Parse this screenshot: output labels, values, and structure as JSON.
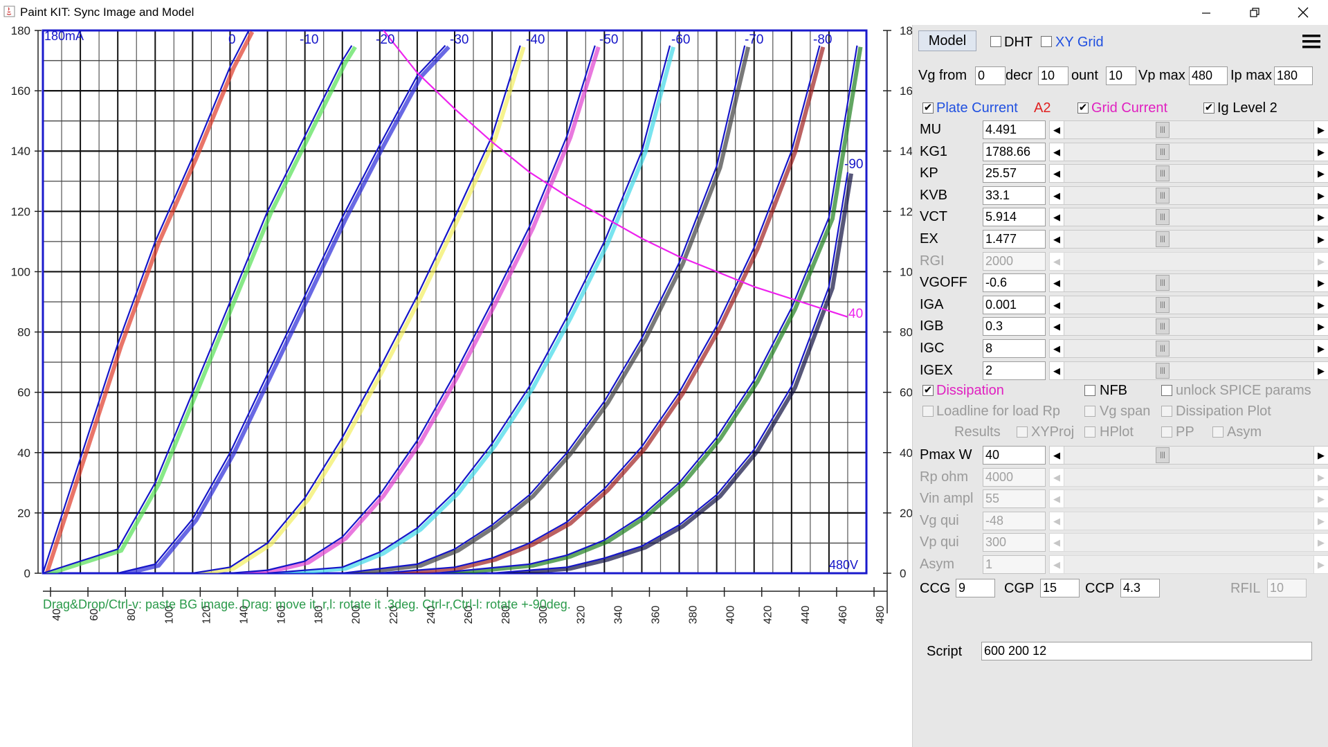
{
  "window": {
    "title": "Paint KIT: Sync Image and Model",
    "controls": [
      "minimize",
      "restore",
      "close"
    ]
  },
  "plot": {
    "y_max_label": "180mA",
    "x_max_label": "480V",
    "y_ticks_left": [
      "180",
      "160",
      "140",
      "120",
      "100",
      "80",
      "60",
      "40",
      "20",
      "0"
    ],
    "y_ticks_right": [
      "18",
      "16",
      "14",
      "12",
      "10",
      "80",
      "60",
      "40",
      "20",
      "0"
    ],
    "x_ticks": [
      "40",
      "60",
      "80",
      "100",
      "120",
      "140",
      "160",
      "180",
      "200",
      "220",
      "240",
      "260",
      "280",
      "300",
      "320",
      "340",
      "360",
      "380",
      "400",
      "420",
      "440",
      "460",
      "480"
    ],
    "curve_labels": [
      "0",
      "-10",
      "-20",
      "-30",
      "-40",
      "-50",
      "-60",
      "-70",
      "-80",
      "-90"
    ],
    "dissipation_label": "40",
    "hint": "Drag&Drop/Ctrl-v: paste BG image. Drag: move it. r,l: rotate it .3deg. Ctrl-r,Ctrl-l: rotate +-90deg.",
    "colors": {
      "frame": "#1a1acc",
      "model_curve": "#1515c8",
      "dissipation": "#ee22ee",
      "hint": "#2a9a4a",
      "bg_curves": [
        "#e03a2a",
        "#55e055",
        "#2a2ad8",
        "#f2ee60",
        "#e040d0",
        "#40d8e8",
        "#404040",
        "#a02020",
        "#208020",
        "#101040"
      ]
    }
  },
  "chart_data": {
    "type": "line",
    "title": "",
    "xlabel": "480V",
    "ylabel": "180mA",
    "xlim": [
      40,
      480
    ],
    "ylim": [
      0,
      180
    ],
    "grid": true,
    "series": [
      {
        "name": "0",
        "x": [
          40,
          60,
          80,
          100,
          120,
          140,
          150
        ],
        "y": [
          0,
          38,
          76,
          110,
          138,
          168,
          180
        ]
      },
      {
        "name": "-10",
        "x": [
          40,
          80,
          100,
          120,
          140,
          160,
          180,
          200,
          205
        ],
        "y": [
          0,
          8,
          30,
          60,
          90,
          120,
          145,
          170,
          175
        ]
      },
      {
        "name": "-20",
        "x": [
          80,
          100,
          120,
          140,
          160,
          180,
          200,
          220,
          240,
          255
        ],
        "y": [
          0,
          3,
          18,
          40,
          66,
          92,
          118,
          142,
          165,
          175
        ]
      },
      {
        "name": "-30",
        "x": [
          120,
          140,
          160,
          180,
          200,
          220,
          240,
          260,
          280,
          295
        ],
        "y": [
          0,
          2,
          10,
          25,
          45,
          68,
          92,
          118,
          145,
          175
        ]
      },
      {
        "name": "-40",
        "x": [
          140,
          160,
          180,
          200,
          220,
          240,
          260,
          280,
          300,
          320,
          335
        ],
        "y": [
          0,
          1,
          4,
          12,
          26,
          44,
          66,
          90,
          115,
          145,
          175
        ]
      },
      {
        "name": "-50",
        "x": [
          160,
          200,
          220,
          240,
          260,
          280,
          300,
          320,
          340,
          360,
          375
        ],
        "y": [
          0,
          2,
          7,
          15,
          27,
          43,
          62,
          85,
          110,
          140,
          175
        ]
      },
      {
        "name": "-60",
        "x": [
          200,
          240,
          260,
          280,
          300,
          320,
          340,
          360,
          380,
          400,
          415
        ],
        "y": [
          0,
          3,
          8,
          16,
          26,
          40,
          57,
          78,
          103,
          135,
          175
        ]
      },
      {
        "name": "-70",
        "x": [
          220,
          260,
          280,
          300,
          320,
          340,
          360,
          380,
          400,
          420,
          440,
          455
        ],
        "y": [
          0,
          2,
          5,
          10,
          17,
          28,
          42,
          60,
          82,
          108,
          140,
          175
        ]
      },
      {
        "name": "-80",
        "x": [
          250,
          300,
          320,
          340,
          360,
          380,
          400,
          420,
          440,
          460,
          475
        ],
        "y": [
          0,
          3,
          6,
          11,
          19,
          30,
          45,
          64,
          88,
          118,
          175
        ]
      },
      {
        "name": "-90",
        "x": [
          280,
          320,
          340,
          360,
          380,
          400,
          420,
          440,
          460,
          470
        ],
        "y": [
          0,
          2,
          5,
          9,
          16,
          26,
          41,
          62,
          95,
          133
        ]
      },
      {
        "name": "Pmax 40 W",
        "x": [
          222,
          240,
          260,
          280,
          300,
          320,
          340,
          360,
          380,
          400,
          420,
          440,
          460,
          470
        ],
        "y": [
          180,
          166,
          154,
          143,
          133,
          125,
          118,
          111,
          105,
          100,
          95,
          91,
          87,
          85
        ]
      }
    ]
  },
  "panel": {
    "model_button": "Model",
    "dht": {
      "label": "DHT",
      "checked": false
    },
    "xy_grid": {
      "label": "XY Grid",
      "checked": false
    },
    "menu_icon": "hamburger-menu-icon",
    "vg_from": {
      "label": "Vg from",
      "value": "0"
    },
    "decr": {
      "label": "decr",
      "value": "10"
    },
    "count": {
      "label": "ount",
      "value": "10"
    },
    "vp_max": {
      "label": "Vp max",
      "value": "480"
    },
    "ip_max": {
      "label": "Ip max",
      "value": "180"
    },
    "plate_current": {
      "label": "Plate Current",
      "checked": true,
      "color": "#2050e0"
    },
    "a2": {
      "label": "A2",
      "color": "#e02020"
    },
    "grid_current": {
      "label": "Grid Current",
      "checked": true,
      "color": "#e020c0"
    },
    "ig_level": {
      "label": "Ig Level 2",
      "checked": true
    },
    "params": [
      {
        "label": "MU",
        "value": "4.491",
        "enabled": true
      },
      {
        "label": "KG1",
        "value": "1788.66",
        "enabled": true
      },
      {
        "label": "KP",
        "value": "25.57",
        "enabled": true
      },
      {
        "label": "KVB",
        "value": "33.1",
        "enabled": true
      },
      {
        "label": "VCT",
        "value": "5.914",
        "enabled": true
      },
      {
        "label": "EX",
        "value": "1.477",
        "enabled": true
      },
      {
        "label": "RGI",
        "value": "2000",
        "enabled": false
      },
      {
        "label": "VGOFF",
        "value": "-0.6",
        "enabled": true
      },
      {
        "label": "IGA",
        "value": "0.001",
        "enabled": true
      },
      {
        "label": "IGB",
        "value": "0.3",
        "enabled": true
      },
      {
        "label": "IGC",
        "value": "8",
        "enabled": true
      },
      {
        "label": "IGEX",
        "value": "2",
        "enabled": true
      }
    ],
    "dissipation": {
      "label": "Dissipation",
      "checked": true,
      "color": "#e020c0"
    },
    "nfb": {
      "label": "NFB",
      "checked": false
    },
    "unlock_spice": {
      "label": "unlock SPICE params",
      "checked": false
    },
    "loadline": {
      "label": "Loadline for load Rp",
      "checked": false
    },
    "vg_span": {
      "label": "Vg span",
      "checked": false
    },
    "dissipation_plot": {
      "label": "Dissipation Plot",
      "checked": false
    },
    "results": {
      "label": "Results"
    },
    "xyproj": {
      "label": "XYProj",
      "checked": false
    },
    "hplot": {
      "label": "HPlot",
      "checked": false
    },
    "pp": {
      "label": "PP",
      "checked": false
    },
    "asym_cb": {
      "label": "Asym",
      "checked": false
    },
    "params2": [
      {
        "label": "Pmax W",
        "value": "40",
        "enabled": true
      },
      {
        "label": "Rp ohm",
        "value": "4000",
        "enabled": false
      },
      {
        "label": "Vin ampl",
        "value": "55",
        "enabled": false
      },
      {
        "label": "Vg qui",
        "value": "-48",
        "enabled": false
      },
      {
        "label": "Vp qui",
        "value": "300",
        "enabled": false
      },
      {
        "label": "Asym",
        "value": "1",
        "enabled": false
      }
    ],
    "ccg": {
      "label": "CCG",
      "value": "9"
    },
    "cgp": {
      "label": "CGP",
      "value": "15"
    },
    "ccp": {
      "label": "CCP",
      "value": "4.3"
    },
    "rfil": {
      "label": "RFIL",
      "value": "10"
    },
    "script": {
      "label": "Script",
      "value": "600 200 12"
    }
  }
}
